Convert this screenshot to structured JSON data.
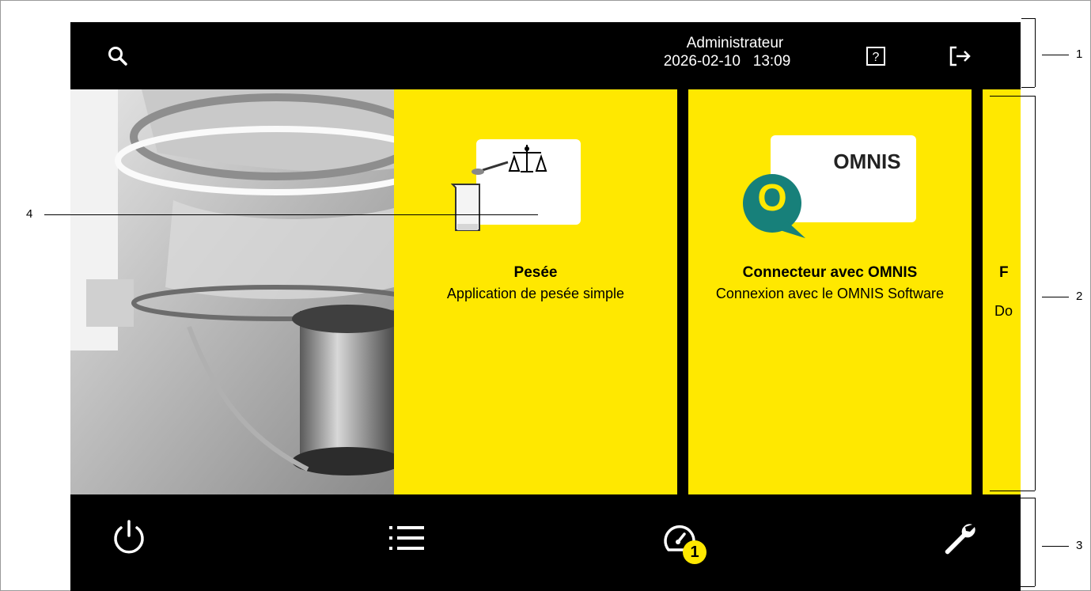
{
  "header": {
    "user": "Administrateur",
    "date": "2026-02-10",
    "time": "13:09"
  },
  "tiles": [
    {
      "title": "Pesée",
      "description": "Application de pesée simple"
    },
    {
      "title": "Connecteur avec OMNIS",
      "description": "Connexion avec le OMNIS Software",
      "logo_text": "OMNIS",
      "logo_letter": "O"
    },
    {
      "title": "F",
      "description": "Do"
    }
  ],
  "bottom_bar": {
    "badge_count": "1"
  },
  "callouts": [
    "1",
    "2",
    "3",
    "4"
  ],
  "colors": {
    "tile": "#ffe800",
    "bar": "#000000",
    "omnis_teal": "#17807a"
  },
  "icons": [
    "search-icon",
    "help-icon",
    "logout-icon",
    "power-icon",
    "list-icon",
    "gauge-icon",
    "wrench-icon"
  ]
}
